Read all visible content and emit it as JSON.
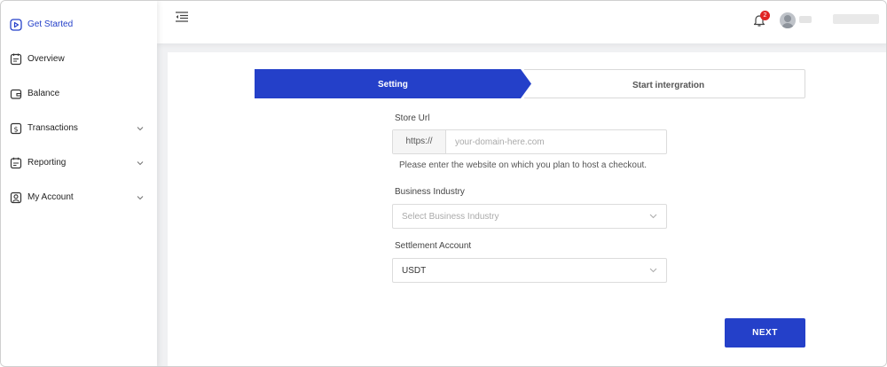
{
  "sidebar": {
    "items": [
      {
        "label": "Get Started",
        "icon": "play-square-icon",
        "active": true,
        "expandable": false
      },
      {
        "label": "Overview",
        "icon": "notepad-icon",
        "active": false,
        "expandable": false
      },
      {
        "label": "Balance",
        "icon": "wallet-icon",
        "active": false,
        "expandable": false
      },
      {
        "label": "Transactions",
        "icon": "dollar-doc-icon",
        "active": false,
        "expandable": true
      },
      {
        "label": "Reporting",
        "icon": "report-icon",
        "active": false,
        "expandable": true
      },
      {
        "label": "My Account",
        "icon": "user-square-icon",
        "active": false,
        "expandable": true
      }
    ]
  },
  "header": {
    "notification_count": "2",
    "icons": [
      "menu-fold-icon",
      "bell-icon",
      "avatar-icon"
    ]
  },
  "steps": [
    {
      "label": "Setting",
      "active": true
    },
    {
      "label": "Start intergration",
      "active": false
    }
  ],
  "form": {
    "store_url": {
      "label": "Store Url",
      "prefix": "https://",
      "value": "",
      "placeholder": "your-domain-here.com",
      "help": "Please enter the website on which you plan to host a checkout."
    },
    "business_industry": {
      "label": "Business Industry",
      "placeholder": "Select Business Industry"
    },
    "settlement_account": {
      "label": "Settlement Account",
      "value": "USDT"
    },
    "next_label": "NEXT"
  },
  "colors": {
    "accent": "#2440c9",
    "badge": "#e02424",
    "background": "#f0f1f3"
  }
}
